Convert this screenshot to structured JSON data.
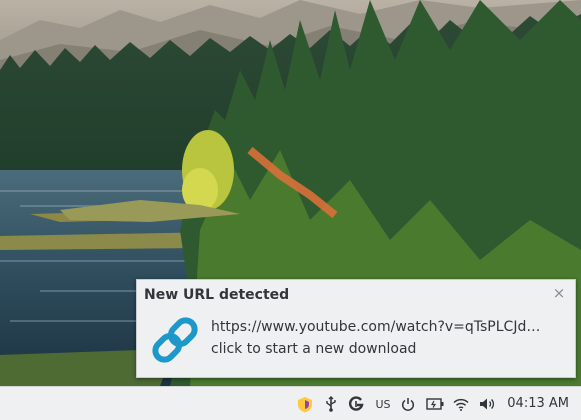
{
  "desktop": {
    "wallpaper": "mountain-lake-forest"
  },
  "notification": {
    "title": "New URL detected",
    "url_text": "https://www.youtube.com/watch?v=qTsPLCJd…",
    "action_text": "click to start a new download",
    "close_glyph": "×",
    "icon": "link-icon",
    "accent_color": "#1d99c9"
  },
  "panel": {
    "tray": [
      {
        "name": "vpn-shield-icon"
      },
      {
        "name": "usb-icon"
      },
      {
        "name": "download-manager-icon"
      },
      {
        "name": "keyboard-layout",
        "text": "US"
      },
      {
        "name": "power-icon"
      },
      {
        "name": "battery-icon"
      },
      {
        "name": "wifi-icon"
      },
      {
        "name": "volume-icon"
      }
    ],
    "keyboard_layout": "US",
    "clock": "04:13 AM"
  }
}
